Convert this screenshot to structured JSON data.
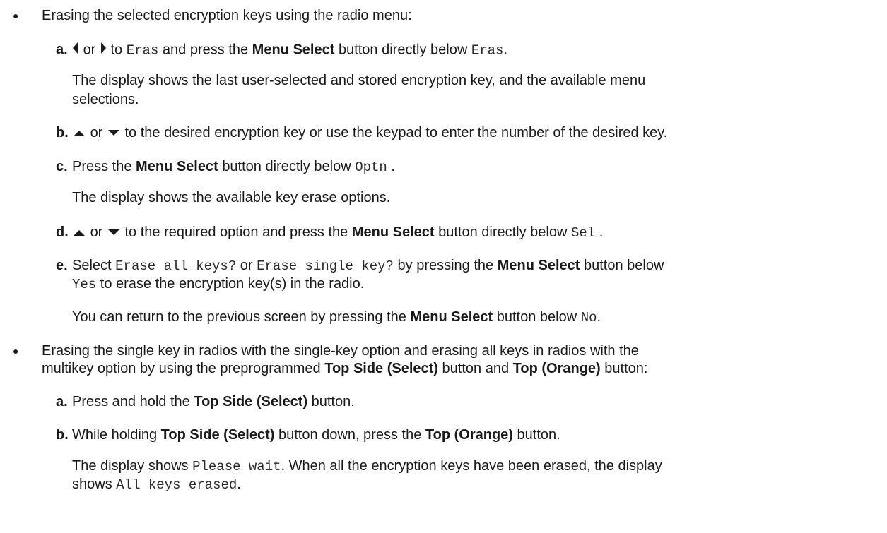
{
  "s1": {
    "bullet": "●",
    "intro": "Erasing the selected encryption keys using the radio menu:",
    "a": {
      "label": "a.",
      "t_or": "or",
      "t_to": "to",
      "code1": "Eras",
      "t_press": "and press the",
      "bold": "Menu Select",
      "t_below": "button directly below",
      "code2": "Eras",
      "end": ".",
      "result_l1": "The display shows the last user-selected and stored encryption key, and the available menu",
      "result_l2": "selections."
    },
    "b": {
      "label": "b.",
      "t_or": "or",
      "text": "to the desired encryption key or use the keypad to enter the number of the desired key."
    },
    "c": {
      "label": "c.",
      "t_press": "Press the",
      "bold": "Menu Select",
      "t_below": "button directly below",
      "code": "Optn",
      "end": " .",
      "result": "The display shows the available key erase options."
    },
    "d": {
      "label": "d.",
      "t_or": "or",
      "t_to": "to the required option and press the",
      "bold": "Menu Select",
      "t_below": "button directly below",
      "code": "Sel",
      "end": " ."
    },
    "e": {
      "label": "e.",
      "t_select": "Select",
      "code1": "Erase all keys?",
      "t_or": "or",
      "code2": "Erase single key?",
      "t_by": "by pressing the",
      "bold": "Menu Select",
      "t_below": "button below",
      "code3": "Yes",
      "t_rest": "to erase the encryption key(s) in the radio.",
      "result_pre": "You can return to the previous screen by pressing the",
      "result_bold": "Menu Select",
      "result_mid": "button below",
      "result_code": "No",
      "result_end": "."
    }
  },
  "s2": {
    "bullet": "●",
    "intro_l1": "Erasing the single key in radios with the single-key option and erasing all keys in radios with the",
    "intro_l2_pre": "multikey option by using the preprogrammed",
    "intro_bold1": "Top Side (Select)",
    "intro_mid": "button and",
    "intro_bold2": "Top (Orange)",
    "intro_end": "button:",
    "a": {
      "label": "a.",
      "t_pre": "Press and hold the",
      "bold": "Top Side (Select)",
      "end": "button."
    },
    "b": {
      "label": "b.",
      "t_pre": "While holding",
      "bold1": "Top Side (Select)",
      "t_mid": "button down, press the",
      "bold2": "Top (Orange)",
      "end": "button.",
      "result_pre": "The display shows",
      "result_code1": "Please wait",
      "result_mid": ". When all the encryption keys have been erased, the display",
      "result_l2_pre": "shows",
      "result_code2": "All keys erased",
      "result_end": "."
    }
  },
  "icons": [
    "left-arrow-icon",
    "right-arrow-icon",
    "up-arrow-icon",
    "down-arrow-icon"
  ]
}
